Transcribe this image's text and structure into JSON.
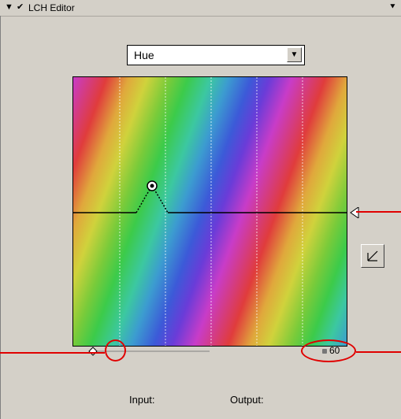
{
  "panel": {
    "title": "LCH Editor",
    "collapse_icon": "triangle-down-icon",
    "check_icon": "checkmark-icon",
    "menu_icon": "menu-arrow-icon"
  },
  "channel_select": {
    "value": "Hue",
    "arrow_icon": "chevron-down-icon"
  },
  "graph": {
    "gridline_count": 5,
    "curve_description_icon": "control-point-icon"
  },
  "slider": {
    "value": "60"
  },
  "footer": {
    "input_label": "Input:",
    "output_label": "Output:"
  },
  "colors": {
    "annotation": "#e00000",
    "panel_bg": "#d4d0c8"
  }
}
